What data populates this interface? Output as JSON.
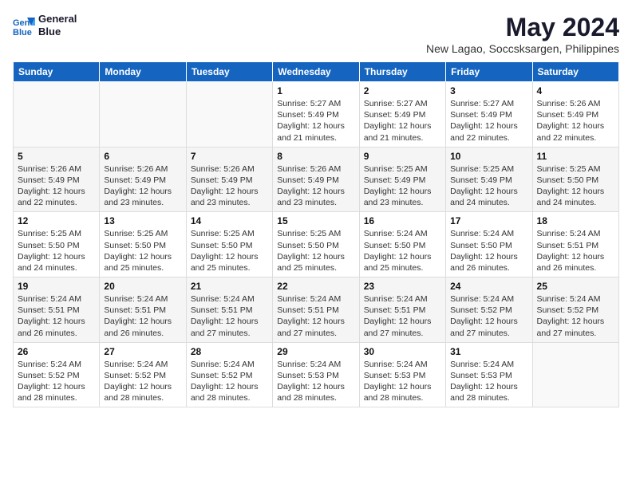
{
  "header": {
    "logo_line1": "General",
    "logo_line2": "Blue",
    "title": "May 2024",
    "subtitle": "New Lagao, Soccsksargen, Philippines"
  },
  "weekdays": [
    "Sunday",
    "Monday",
    "Tuesday",
    "Wednesday",
    "Thursday",
    "Friday",
    "Saturday"
  ],
  "weeks": [
    [
      {
        "day": "",
        "info": ""
      },
      {
        "day": "",
        "info": ""
      },
      {
        "day": "",
        "info": ""
      },
      {
        "day": "1",
        "info": "Sunrise: 5:27 AM\nSunset: 5:49 PM\nDaylight: 12 hours\nand 21 minutes."
      },
      {
        "day": "2",
        "info": "Sunrise: 5:27 AM\nSunset: 5:49 PM\nDaylight: 12 hours\nand 21 minutes."
      },
      {
        "day": "3",
        "info": "Sunrise: 5:27 AM\nSunset: 5:49 PM\nDaylight: 12 hours\nand 22 minutes."
      },
      {
        "day": "4",
        "info": "Sunrise: 5:26 AM\nSunset: 5:49 PM\nDaylight: 12 hours\nand 22 minutes."
      }
    ],
    [
      {
        "day": "5",
        "info": "Sunrise: 5:26 AM\nSunset: 5:49 PM\nDaylight: 12 hours\nand 22 minutes."
      },
      {
        "day": "6",
        "info": "Sunrise: 5:26 AM\nSunset: 5:49 PM\nDaylight: 12 hours\nand 23 minutes."
      },
      {
        "day": "7",
        "info": "Sunrise: 5:26 AM\nSunset: 5:49 PM\nDaylight: 12 hours\nand 23 minutes."
      },
      {
        "day": "8",
        "info": "Sunrise: 5:26 AM\nSunset: 5:49 PM\nDaylight: 12 hours\nand 23 minutes."
      },
      {
        "day": "9",
        "info": "Sunrise: 5:25 AM\nSunset: 5:49 PM\nDaylight: 12 hours\nand 23 minutes."
      },
      {
        "day": "10",
        "info": "Sunrise: 5:25 AM\nSunset: 5:49 PM\nDaylight: 12 hours\nand 24 minutes."
      },
      {
        "day": "11",
        "info": "Sunrise: 5:25 AM\nSunset: 5:50 PM\nDaylight: 12 hours\nand 24 minutes."
      }
    ],
    [
      {
        "day": "12",
        "info": "Sunrise: 5:25 AM\nSunset: 5:50 PM\nDaylight: 12 hours\nand 24 minutes."
      },
      {
        "day": "13",
        "info": "Sunrise: 5:25 AM\nSunset: 5:50 PM\nDaylight: 12 hours\nand 25 minutes."
      },
      {
        "day": "14",
        "info": "Sunrise: 5:25 AM\nSunset: 5:50 PM\nDaylight: 12 hours\nand 25 minutes."
      },
      {
        "day": "15",
        "info": "Sunrise: 5:25 AM\nSunset: 5:50 PM\nDaylight: 12 hours\nand 25 minutes."
      },
      {
        "day": "16",
        "info": "Sunrise: 5:24 AM\nSunset: 5:50 PM\nDaylight: 12 hours\nand 25 minutes."
      },
      {
        "day": "17",
        "info": "Sunrise: 5:24 AM\nSunset: 5:50 PM\nDaylight: 12 hours\nand 26 minutes."
      },
      {
        "day": "18",
        "info": "Sunrise: 5:24 AM\nSunset: 5:51 PM\nDaylight: 12 hours\nand 26 minutes."
      }
    ],
    [
      {
        "day": "19",
        "info": "Sunrise: 5:24 AM\nSunset: 5:51 PM\nDaylight: 12 hours\nand 26 minutes."
      },
      {
        "day": "20",
        "info": "Sunrise: 5:24 AM\nSunset: 5:51 PM\nDaylight: 12 hours\nand 26 minutes."
      },
      {
        "day": "21",
        "info": "Sunrise: 5:24 AM\nSunset: 5:51 PM\nDaylight: 12 hours\nand 27 minutes."
      },
      {
        "day": "22",
        "info": "Sunrise: 5:24 AM\nSunset: 5:51 PM\nDaylight: 12 hours\nand 27 minutes."
      },
      {
        "day": "23",
        "info": "Sunrise: 5:24 AM\nSunset: 5:51 PM\nDaylight: 12 hours\nand 27 minutes."
      },
      {
        "day": "24",
        "info": "Sunrise: 5:24 AM\nSunset: 5:52 PM\nDaylight: 12 hours\nand 27 minutes."
      },
      {
        "day": "25",
        "info": "Sunrise: 5:24 AM\nSunset: 5:52 PM\nDaylight: 12 hours\nand 27 minutes."
      }
    ],
    [
      {
        "day": "26",
        "info": "Sunrise: 5:24 AM\nSunset: 5:52 PM\nDaylight: 12 hours\nand 28 minutes."
      },
      {
        "day": "27",
        "info": "Sunrise: 5:24 AM\nSunset: 5:52 PM\nDaylight: 12 hours\nand 28 minutes."
      },
      {
        "day": "28",
        "info": "Sunrise: 5:24 AM\nSunset: 5:52 PM\nDaylight: 12 hours\nand 28 minutes."
      },
      {
        "day": "29",
        "info": "Sunrise: 5:24 AM\nSunset: 5:53 PM\nDaylight: 12 hours\nand 28 minutes."
      },
      {
        "day": "30",
        "info": "Sunrise: 5:24 AM\nSunset: 5:53 PM\nDaylight: 12 hours\nand 28 minutes."
      },
      {
        "day": "31",
        "info": "Sunrise: 5:24 AM\nSunset: 5:53 PM\nDaylight: 12 hours\nand 28 minutes."
      },
      {
        "day": "",
        "info": ""
      }
    ]
  ]
}
